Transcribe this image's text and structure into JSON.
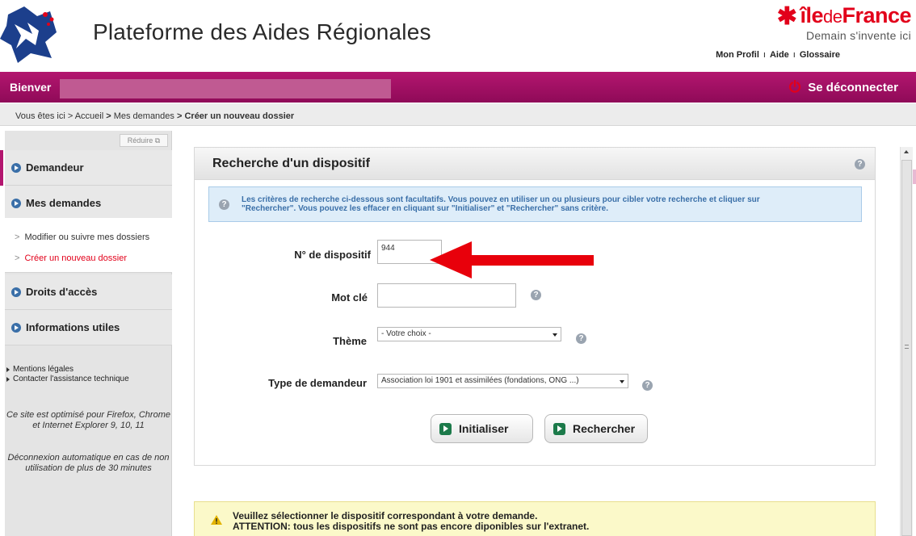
{
  "header": {
    "site_title": "Plateforme des Aides Régionales",
    "brand": {
      "part1": "île",
      "part2": "de",
      "part3": "France",
      "tagline": "Demain s'invente ici"
    },
    "top_links": [
      "Mon Profil",
      "Aide",
      "Glossaire"
    ]
  },
  "welcome_bar": {
    "greeting": "Bienver",
    "logout_label": "Se déconnecter"
  },
  "breadcrumb": {
    "prefix": "Vous êtes ici > ",
    "home": "Accueil",
    "sep": " > ",
    "demandes": "Mes demandes",
    "current": "Créer un nouveau dossier"
  },
  "sidebar": {
    "reduce_label": "Réduire",
    "items": [
      {
        "label": "Demandeur"
      },
      {
        "label": "Mes demandes"
      },
      {
        "label": "Droits d'accès"
      },
      {
        "label": "Informations utiles"
      }
    ],
    "subitems": [
      {
        "label": "Modifier ou suivre mes dossiers"
      },
      {
        "label": "Créer un nouveau dossier"
      }
    ],
    "links": [
      "Mentions légales",
      "Contacter l'assistance technique"
    ],
    "note_browsers": "Ce site est optimisé pour Firefox, Chrome et Internet Explorer 9, 10, 11",
    "note_logout": "Déconnexion automatique en cas de non utilisation de plus de 30 minutes"
  },
  "panel": {
    "title": "Recherche d'un dispositif",
    "info_line1": "Les critères de recherche ci-dessous sont facultatifs. Vous pouvez en utiliser un ou plusieurs pour cibler votre recherche et cliquer sur",
    "info_line2": "\"Rechercher\". Vous pouvez les effacer en cliquant sur \"Initialiser\" et \"Rechercher\" sans critère.",
    "fields": {
      "dispositif_label": "N° de dispositif",
      "dispositif_value": "944",
      "motcle_label": "Mot clé",
      "motcle_value": "",
      "theme_label": "Thème",
      "theme_value": "- Votre choix -",
      "type_label": "Type de demandeur",
      "type_value": "Association loi 1901 et assimilées (fondations, ONG ...)"
    },
    "buttons": {
      "reset": "Initialiser",
      "search": "Rechercher"
    }
  },
  "warning": {
    "line1": "Veuillez sélectionner le dispositif correspondant à votre demande.",
    "line2": "ATTENTION: tous les dispositifs ne sont pas encore diponibles sur l'extranet."
  },
  "colors": {
    "brand_red": "#e2001a",
    "bar_purple": "#a3106a",
    "accent_blue": "#3a6fa8",
    "button_green": "#1c7a4a",
    "annotation_arrow": "#e8000b"
  },
  "icons": [
    "region-map-logo-icon",
    "power-icon",
    "help-icon",
    "info-icon",
    "warning-icon",
    "arrow-right-icon",
    "red-annotation-arrow-icon"
  ]
}
